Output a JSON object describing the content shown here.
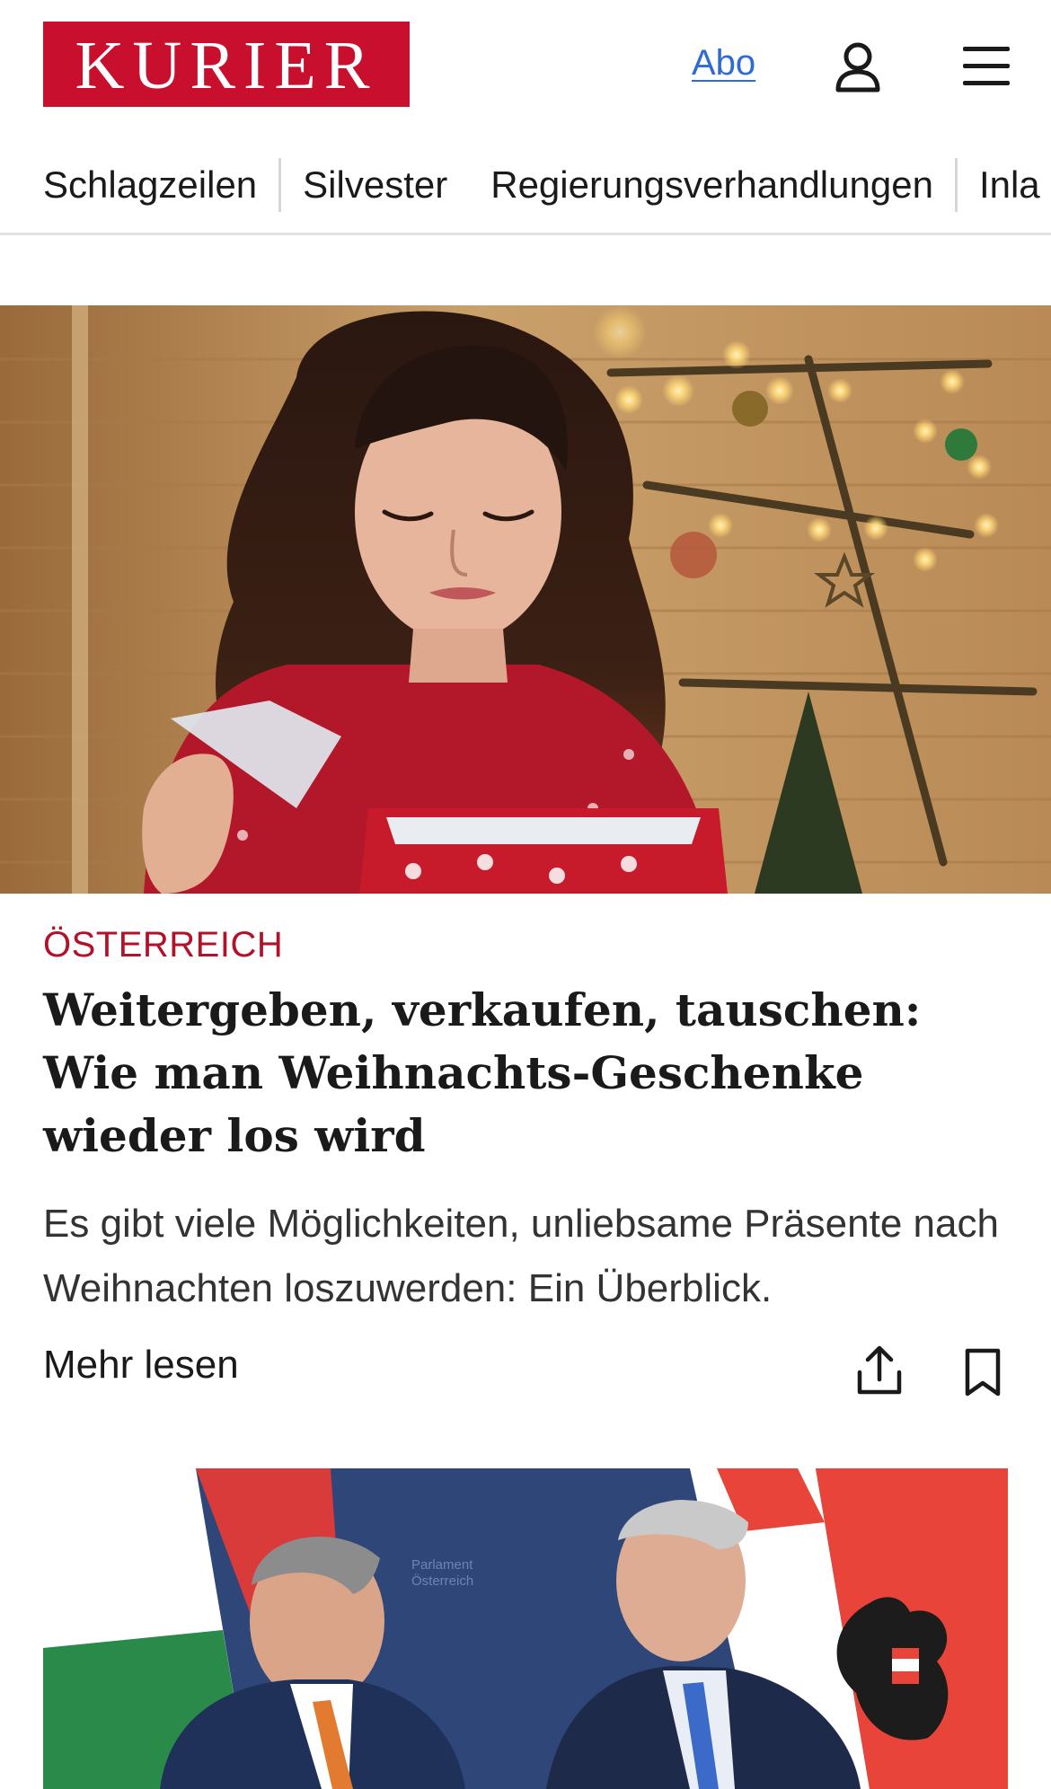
{
  "header": {
    "logo_text": "KURIER",
    "abo_label": "Abo",
    "user_icon": "user-icon",
    "menu_icon": "hamburger-menu-icon",
    "brand_color": "#c8102e",
    "link_color": "#2f6bd6"
  },
  "nav": {
    "items": [
      {
        "label": "Schlagzeilen"
      },
      {
        "label": "Silvester"
      },
      {
        "label": "Regierungsverhandlungen"
      },
      {
        "label": "Inla"
      }
    ]
  },
  "articles": [
    {
      "category": "ÖSTERREICH",
      "headline": "Weitergeben, verkaufen, tauschen: Wie man Weihnachts-Geschenke wieder los wird",
      "teaser": "Es gibt viele Möglichkeiten, unliebsame Präsente nach Weihnachten loszuwerden: Ein Überblick.",
      "read_more": "Mehr lesen",
      "share_icon": "share-icon",
      "bookmark_icon": "bookmark-icon",
      "category_color": "#b3102a"
    }
  ],
  "second_image_text": {
    "line1": "Parlament",
    "line2": "Österreich"
  }
}
